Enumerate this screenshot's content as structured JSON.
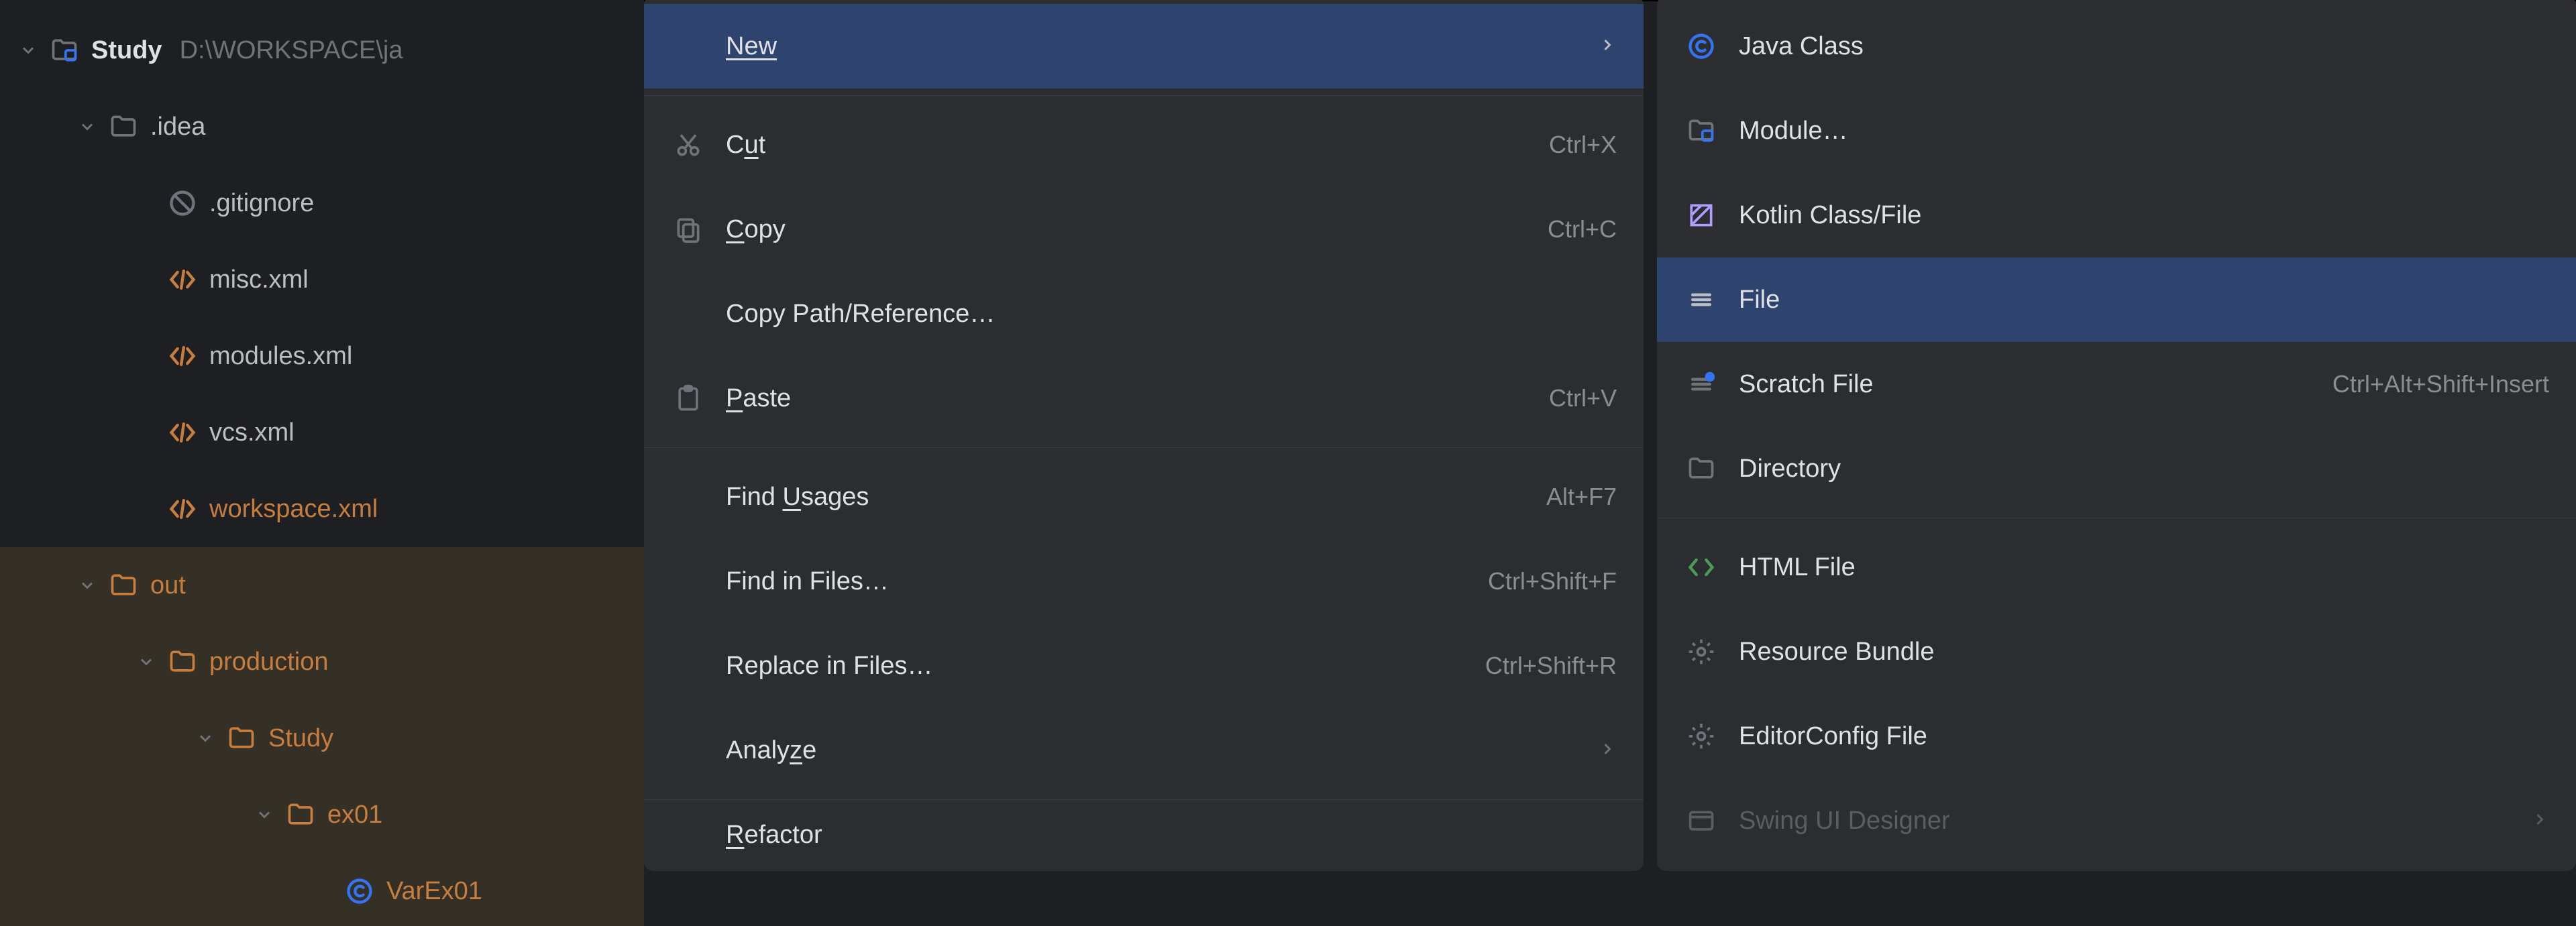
{
  "tree": {
    "root": {
      "name": "Study",
      "path": "D:\\WORKSPACE\\ja"
    },
    "idea": {
      "name": ".idea",
      "files": [
        ".gitignore",
        "misc.xml",
        "modules.xml",
        "vcs.xml",
        "workspace.xml"
      ]
    },
    "out": {
      "name": "out",
      "production": "production",
      "study": "Study",
      "ex01": "ex01",
      "varex01": "VarEx01"
    }
  },
  "context_menu": {
    "new": "New",
    "cut": {
      "label": "Cut",
      "shortcut": "Ctrl+X"
    },
    "copy": {
      "label": "Copy",
      "shortcut": "Ctrl+C"
    },
    "copy_path": "Copy Path/Reference…",
    "paste": {
      "label": "Paste",
      "shortcut": "Ctrl+V"
    },
    "find_usages": {
      "label": "Find Usages",
      "shortcut": "Alt+F7"
    },
    "find_in_files": {
      "label": "Find in Files…",
      "shortcut": "Ctrl+Shift+F"
    },
    "replace_in_files": {
      "label": "Replace in Files…",
      "shortcut": "Ctrl+Shift+R"
    },
    "analyze": "Analyze",
    "refactor": "Refactor"
  },
  "new_submenu": {
    "java_class": "Java Class",
    "module": "Module…",
    "kotlin": "Kotlin Class/File",
    "file": "File",
    "scratch": {
      "label": "Scratch File",
      "shortcut": "Ctrl+Alt+Shift+Insert"
    },
    "directory": "Directory",
    "html": "HTML File",
    "resource_bundle": "Resource Bundle",
    "editorconfig": "EditorConfig File",
    "swing": "Swing UI Designer"
  }
}
